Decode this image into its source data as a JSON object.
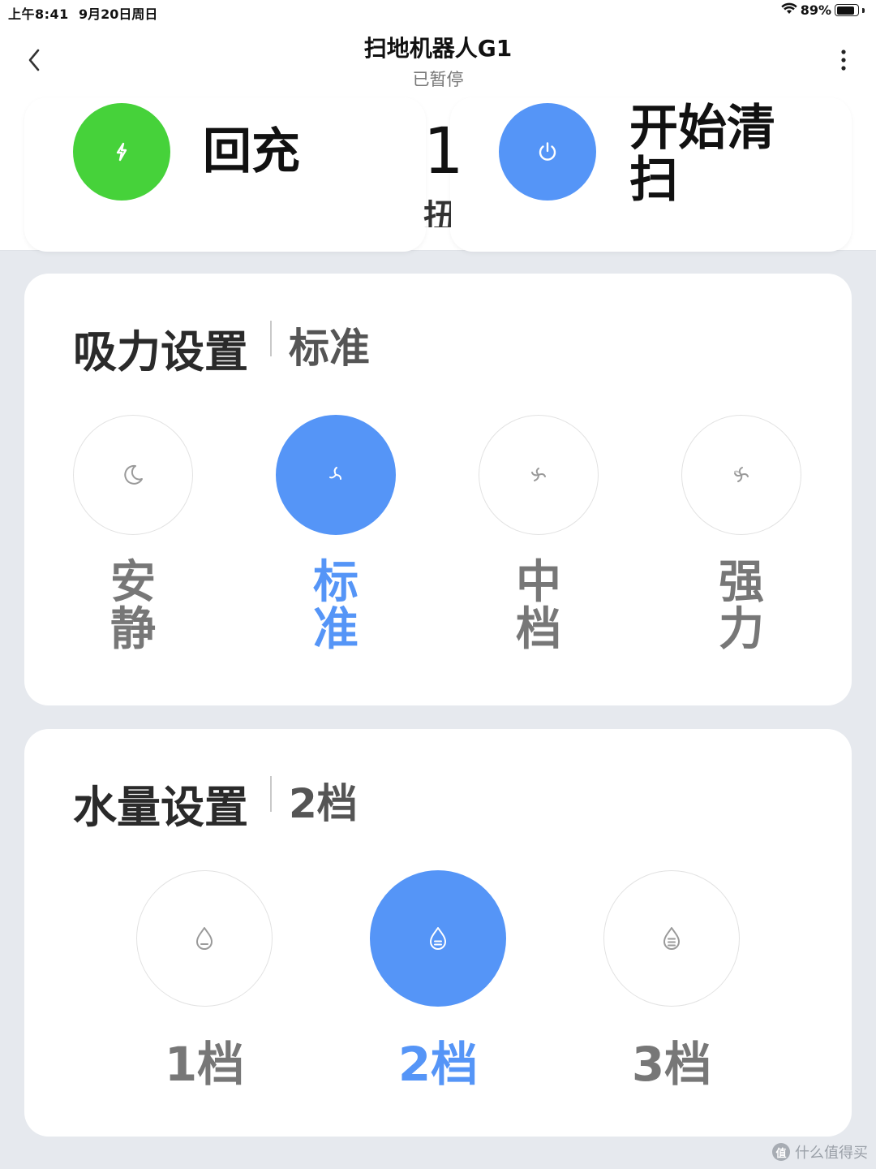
{
  "status_bar": {
    "time": "上午8:41",
    "date": "9月20日周日",
    "battery_percent": "89%",
    "battery_level": 0.89,
    "wifi_icon": "wifi-icon"
  },
  "header": {
    "title": "扫地机器人G1",
    "subtitle": "已暂停",
    "back_icon": "chevron-left-icon",
    "more_icon": "more-vertical-icon"
  },
  "actions": {
    "charge_label": "回充",
    "charge_color": "#46d23a",
    "start_line1": "开始清",
    "start_line2": "扫",
    "start_color": "#5595f7",
    "middle_number": "1",
    "middle_text": "扭"
  },
  "suction": {
    "title": "吸力设置",
    "value": "标准",
    "options": [
      {
        "line1": "安",
        "line2": "静",
        "icon": "moon-icon",
        "active": false
      },
      {
        "line1": "标",
        "line2": "准",
        "icon": "fan-icon",
        "active": true
      },
      {
        "line1": "中",
        "line2": "档",
        "icon": "fan-icon",
        "active": false
      },
      {
        "line1": "强",
        "line2": "力",
        "icon": "fan-icon",
        "active": false
      }
    ]
  },
  "water": {
    "title": "水量设置",
    "value": "2档",
    "options": [
      {
        "label": "1档",
        "icon": "water-drop-low-icon",
        "active": false
      },
      {
        "label": "2档",
        "icon": "water-drop-mid-icon",
        "active": true
      },
      {
        "label": "3档",
        "icon": "water-drop-high-icon",
        "active": false
      }
    ]
  },
  "watermark": {
    "badge": "值",
    "text": "什么值得买"
  },
  "colors": {
    "accent": "#5595f7",
    "green": "#46d23a",
    "inactive_text": "#777777",
    "background": "#e6e9ee"
  }
}
